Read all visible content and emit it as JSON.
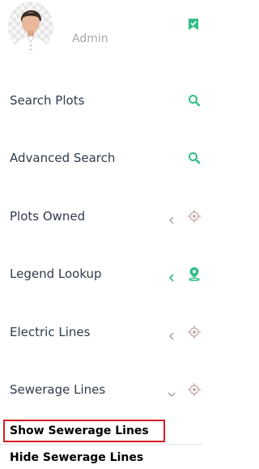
{
  "profile": {
    "name": "Admin",
    "status_icon": "bookmark-check-icon"
  },
  "menu": [
    {
      "label": "Search Plots",
      "icon": "search-icon",
      "chevron": ""
    },
    {
      "label": "Advanced Search",
      "icon": "search-icon",
      "chevron": ""
    },
    {
      "label": "Plots Owned",
      "icon": "target-icon",
      "chevron": "left"
    },
    {
      "label": "Legend Lookup",
      "icon": "location-pin-icon",
      "chevron": "left"
    },
    {
      "label": "Electric Lines",
      "icon": "target-icon",
      "chevron": "left"
    },
    {
      "label": "Sewerage Lines",
      "icon": "target-icon",
      "chevron": "down"
    }
  ],
  "submenu": [
    {
      "label": "Show Sewerage Lines",
      "highlighted": true
    },
    {
      "label": "Hide Sewerage Lines",
      "highlighted": false
    }
  ],
  "colors": {
    "accent_green": "#2fbf86",
    "muted_icon": "#c9b3b3",
    "highlight_red": "#d21f26"
  }
}
